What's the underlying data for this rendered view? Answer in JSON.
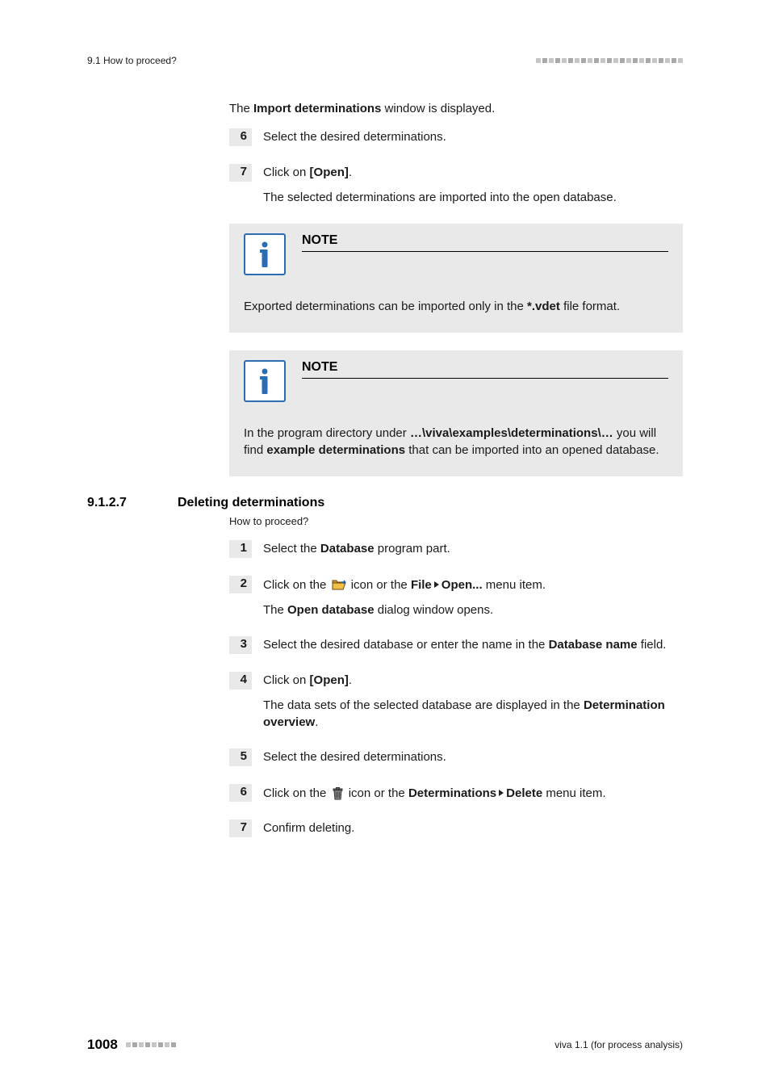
{
  "header": {
    "left": "9.1 How to proceed?"
  },
  "intro": {
    "prefix": "The ",
    "bold": "Import determinations",
    "suffix": " window is displayed."
  },
  "stepsA": {
    "s6": {
      "num": "6",
      "text": "Select the desired determinations."
    },
    "s7": {
      "num": "7",
      "line1": {
        "prefix": "Click on ",
        "bold": "[Open]",
        "suffix": "."
      },
      "line2": "The selected determinations are imported into the open database."
    }
  },
  "note1": {
    "title": "NOTE",
    "body": {
      "prefix": "Exported determinations can be imported only in the ",
      "bold": "*.vdet",
      "suffix": " file format."
    }
  },
  "note2": {
    "title": "NOTE",
    "body": {
      "prefix": "In the program directory under ",
      "bold1": "…\\viva\\examples\\determinations\\…",
      "mid": " you will find ",
      "bold2": "example determinations",
      "suffix": " that can be imported into an opened database."
    }
  },
  "section": {
    "num": "9.1.2.7",
    "title": "Deleting determinations",
    "sub": "How to proceed?"
  },
  "stepsB": {
    "s1": {
      "num": "1",
      "prefix": "Select the ",
      "bold": "Database",
      "suffix": " program part."
    },
    "s2": {
      "num": "2",
      "p1": "Click on the ",
      "p2": " icon or the ",
      "bold_file": "File",
      "bold_open": "Open...",
      "p3": " menu item.",
      "line2": {
        "prefix": "The ",
        "bold": "Open database",
        "suffix": " dialog window opens."
      }
    },
    "s3": {
      "num": "3",
      "prefix": "Select the desired database or enter the name in the ",
      "bold": "Database name",
      "suffix": " field."
    },
    "s4": {
      "num": "4",
      "line1": {
        "prefix": "Click on ",
        "bold": "[Open]",
        "suffix": "."
      },
      "line2": {
        "prefix": "The data sets of the selected database are displayed in the ",
        "bold": "Determination overview",
        "suffix": "."
      }
    },
    "s5": {
      "num": "5",
      "text": "Select the desired determinations."
    },
    "s6": {
      "num": "6",
      "p1": "Click on the ",
      "p2": " icon or the ",
      "bold_det": "Determinations",
      "bold_del": "Delete",
      "p3": " menu item."
    },
    "s7": {
      "num": "7",
      "text": "Confirm deleting."
    }
  },
  "footer": {
    "page": "1008",
    "right": "viva 1.1 (for process analysis)"
  }
}
